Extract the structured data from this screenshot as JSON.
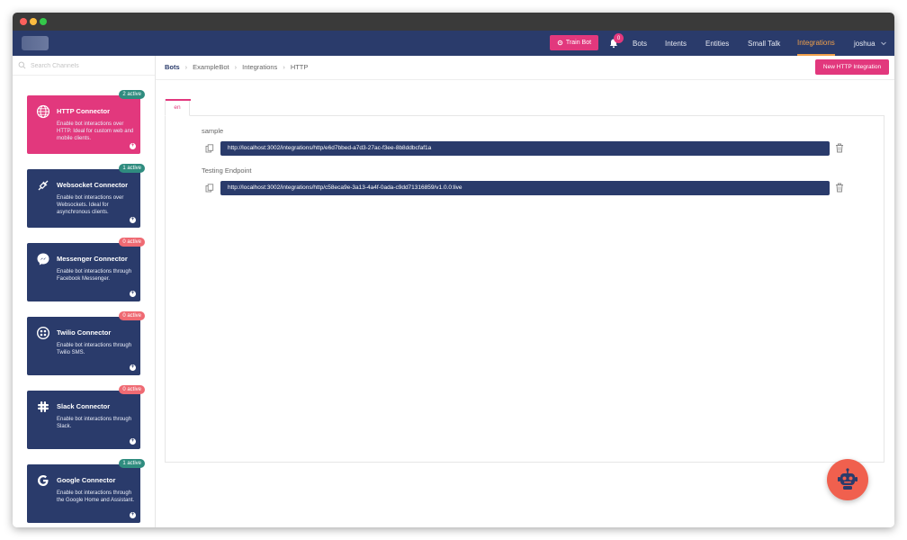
{
  "navbar": {
    "train_label": "Train Bot",
    "notification_count": "0",
    "items": [
      "Bots",
      "Intents",
      "Entities",
      "Small Talk",
      "Integrations",
      "joshua"
    ],
    "active": "Integrations"
  },
  "sidebar": {
    "search_placeholder": "Search Channels",
    "cards": [
      {
        "title": "HTTP Connector",
        "desc": "Enable bot interactions over HTTP. Ideal for custom web and mobile clients.",
        "badge": "2 active",
        "badge_color": "#2f8c7f",
        "icon": "globe-icon"
      },
      {
        "title": "Websocket Connector",
        "desc": "Enable bot interactions over Websockets. Ideal for asynchronous clients.",
        "badge": "1 active",
        "badge_color": "#2f8c7f",
        "icon": "plug-icon"
      },
      {
        "title": "Messenger Connector",
        "desc": "Enable bot interactions through Facebook Messenger.",
        "badge": "0 active",
        "badge_color": "#ef6a73",
        "icon": "messenger-icon"
      },
      {
        "title": "Twilio Connector",
        "desc": "Enable bot interactions through Twilio SMS.",
        "badge": "0 active",
        "badge_color": "#ef6a73",
        "icon": "twilio-icon"
      },
      {
        "title": "Slack Connector",
        "desc": "Enable bot interactions through Slack.",
        "badge": "0 active",
        "badge_color": "#ef6a73",
        "icon": "slack-icon"
      },
      {
        "title": "Google Connector",
        "desc": "Enable bot interactions through the Google Home and Assistant.",
        "badge": "1 active",
        "badge_color": "#2f8c7f",
        "icon": "google-icon"
      }
    ]
  },
  "main": {
    "breadcrumb": [
      "Bots",
      "ExampleBot",
      "Integrations",
      "HTTP"
    ],
    "new_button_label": "New HTTP Integration",
    "tab_label": "en",
    "endpoints": [
      {
        "name": "sample",
        "url": "http://localhost:3002/integrations/http/e6d7bbed-a7d3-27ac-f3ee-8b8ddbcfaf1a"
      },
      {
        "name": "Testing Endpoint",
        "url": "http://localhost:3002/integrations/http/c58eca9e-3a13-4a4f-0ada-c9dd71316859/v1.0.0:live"
      }
    ]
  },
  "colors": {
    "navy": "#2a3b6b",
    "pink": "#e2387d",
    "orange": "#f0a04b",
    "fab": "#f0604e"
  }
}
